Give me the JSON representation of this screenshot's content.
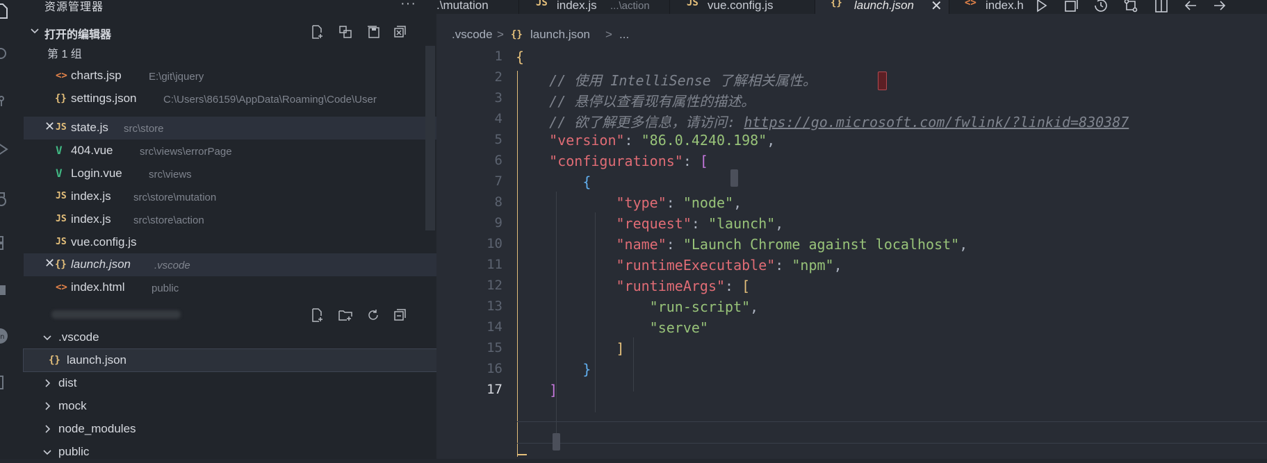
{
  "activity_icons": [
    "explorer-icon",
    "search-icon",
    "source-control-icon",
    "run-debug-icon",
    "remote-icon",
    "extensions-icon",
    "remote-explorer-icon",
    "account-icon",
    "settings-icon"
  ],
  "sidebar": {
    "title": "资源管理器",
    "more": "···",
    "open_editors": {
      "title": "打开的编辑器",
      "group_label": "第 1 组",
      "items": [
        {
          "icon": "<>",
          "name": "charts.jsp",
          "desc": "E:\\git\\jquery"
        },
        {
          "icon": "{}",
          "name": "settings.json",
          "desc": "C:\\Users\\86159\\AppData\\Roaming\\Code\\User"
        },
        {
          "icon": "JS",
          "name": "state.js",
          "desc": "src\\store"
        },
        {
          "icon": "V",
          "name": "404.vue",
          "desc": "src\\views\\errorPage"
        },
        {
          "icon": "V",
          "name": "Login.vue",
          "desc": "src\\views"
        },
        {
          "icon": "JS",
          "name": "index.js",
          "desc": "src\\store\\mutation"
        },
        {
          "icon": "JS",
          "name": "index.js",
          "desc": "src\\store\\action"
        },
        {
          "icon": "JS",
          "name": "vue.config.js",
          "desc": ""
        },
        {
          "icon": "{}",
          "name": "launch.json",
          "desc": ".vscode"
        },
        {
          "icon": "<>",
          "name": "index.html",
          "desc": "public"
        }
      ],
      "close_glyph": "✕"
    },
    "tree": [
      {
        "name": ".vscode"
      },
      {
        "icon": "{}",
        "name": "launch.json"
      },
      {
        "name": "dist"
      },
      {
        "name": "mock"
      },
      {
        "name": "node_modules"
      },
      {
        "name": "public"
      }
    ]
  },
  "tabs": [
    {
      "label": ".\\mutation"
    },
    {
      "icon": "JS",
      "label": "index.js",
      "desc": "...\\action"
    },
    {
      "icon": "JS",
      "label": "vue.config.js"
    },
    {
      "icon": "{}",
      "label": "launch.json",
      "close": "✕"
    },
    {
      "icon": "<>",
      "label": "index.h"
    }
  ],
  "breadcrumb": {
    "folder": ".vscode",
    "sep": ">",
    "icon": "{}",
    "file": "launch.json",
    "tail": "..."
  },
  "line_numbers": [
    "1",
    "2",
    "3",
    "4",
    "5",
    "6",
    "7",
    "8",
    "9",
    "10",
    "11",
    "12",
    "13",
    "14",
    "15",
    "16",
    "17"
  ],
  "code": {
    "l1_brace": "{",
    "l2_comment": "// 使用 IntelliSense 了解相关属性。",
    "l3_comment": "// 悬停以查看现有属性的描述。",
    "l4_comment": "// 欲了解更多信息，请访问: ",
    "l4_link": "https://go.microsoft.com/fwlink/?linkid=830387",
    "l5_key": "\"version\"",
    "l5_val": "\"86.0.4240.198\"",
    "l6_key": "\"configurations\"",
    "l6_br": "[",
    "l7_br": "{",
    "l8_key": "\"type\"",
    "l8_val": "\"node\"",
    "l9_key": "\"request\"",
    "l9_val": "\"launch\"",
    "l10_key": "\"name\"",
    "l10_val": "\"Launch Chrome against localhost\"",
    "l11_key": "\"runtimeExecutable\"",
    "l11_val": "\"npm\"",
    "l12_key": "\"runtimeArgs\"",
    "l12_br": "[",
    "l13_val": "\"run-script\"",
    "l14_val": "\"serve\"",
    "l15_br": "]",
    "l16_br": "}",
    "l17_br": "]",
    "colon": ": ",
    "comma": ","
  }
}
